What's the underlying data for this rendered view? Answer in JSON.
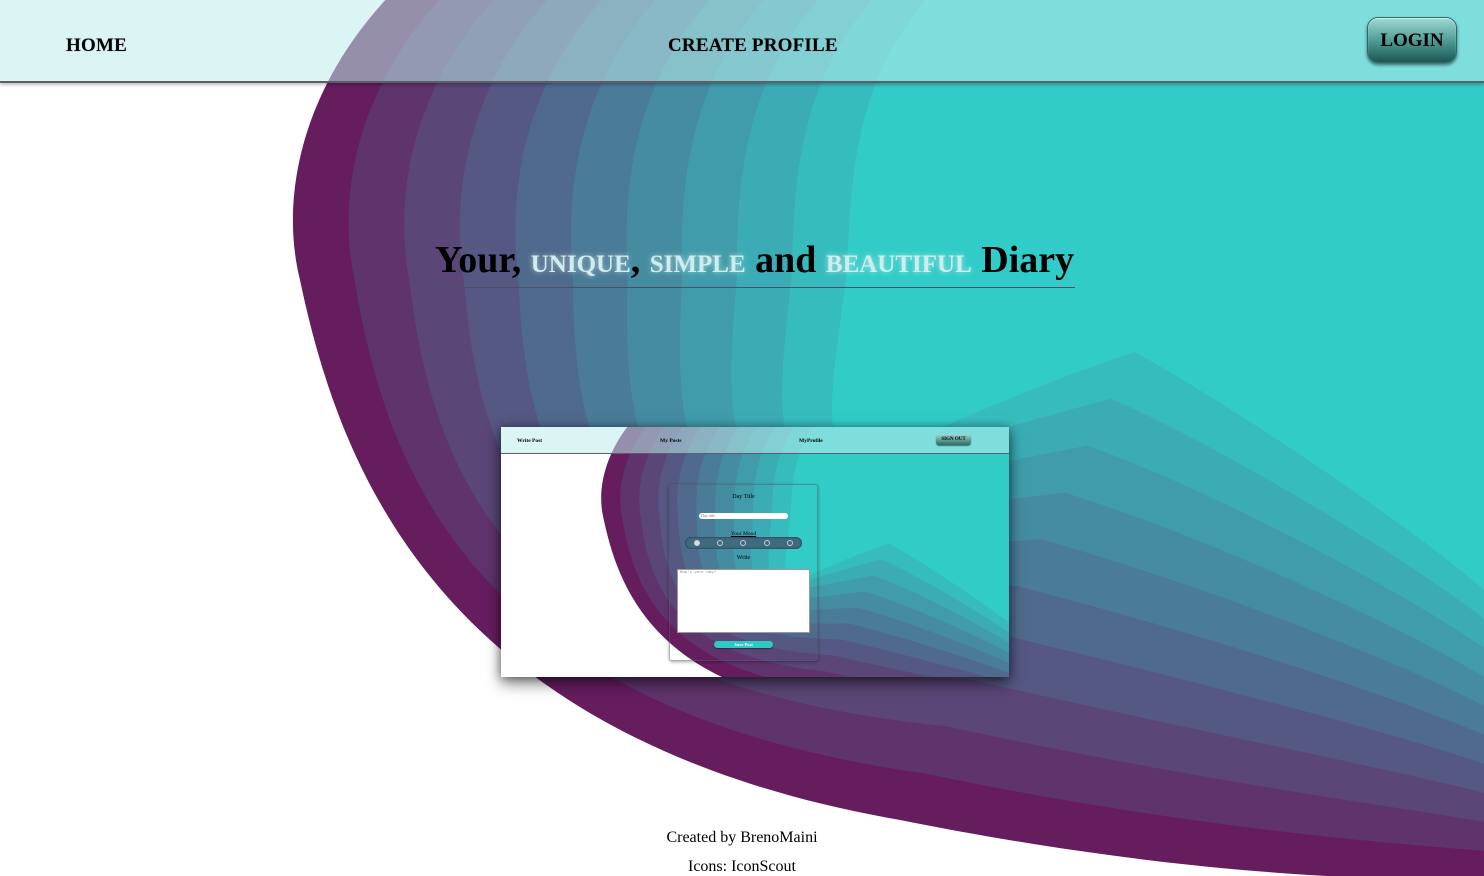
{
  "navbar": {
    "home_label": "HOME",
    "create_profile_label": "CREATE PROFILE",
    "login_label": "LOGIN"
  },
  "hero": {
    "word_your": "Your,",
    "word_unique": "UNIQUE",
    "comma_1": ",",
    "word_simple": "SIMPLE",
    "word_and": "and",
    "word_beautiful": "BEAUTIFUL",
    "word_diary": "Diary"
  },
  "preview": {
    "nav": {
      "write_post_label": "Write Post",
      "my_posts_label": "My Posts",
      "my_profile_label": "MyProfile",
      "sign_out_label": "SIGN OUT"
    },
    "form": {
      "day_title_label": "Day Title",
      "day_title_placeholder": "Day title",
      "your_mood_label": "Your Mood",
      "write_label": "Write",
      "write_placeholder": "How's your day?",
      "save_label": "Save Post"
    }
  },
  "footer": {
    "created_by": "Created by BrenoMaini",
    "icons_credit": "Icons: IconScout"
  },
  "colors": {
    "wave_outer": "#661d5e",
    "wave_inner": "#32ccc8",
    "navbar": "#bfeaea",
    "accent": "#2fc9c4"
  }
}
